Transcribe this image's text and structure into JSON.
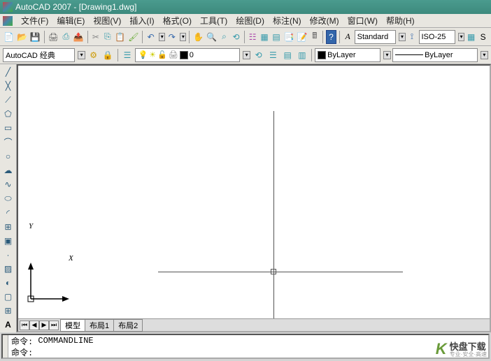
{
  "title": "AutoCAD 2007 - [Drawing1.dwg]",
  "menus": [
    "文件(F)",
    "编辑(E)",
    "视图(V)",
    "插入(I)",
    "格式(O)",
    "工具(T)",
    "绘图(D)",
    "标注(N)",
    "修改(M)",
    "窗口(W)",
    "帮助(H)"
  ],
  "toolbar1": {
    "style_combo": "Standard",
    "dimstyle_combo": "ISO-25",
    "sbtn": "S"
  },
  "toolbar2": {
    "workspace": "AutoCAD 经典",
    "layer_props": [
      "0"
    ],
    "color_combo": "ByLayer",
    "linetype_combo": "ByLayer"
  },
  "ucs": {
    "x": "X",
    "y": "Y"
  },
  "tabs": [
    "模型",
    "布局1",
    "布局2"
  ],
  "command": {
    "prefix": "命令:",
    "last": "COMMANDLINE",
    "current": "命令:"
  },
  "draw_tools": [
    "line",
    "xline",
    "polyline",
    "polygon",
    "rectangle",
    "arc",
    "circle",
    "revcloud",
    "spline",
    "ellipse",
    "ellipse-arc",
    "insert",
    "block",
    "point",
    "hatch",
    "gradient",
    "region",
    "table",
    "mtext"
  ],
  "watermark": {
    "logo": "K",
    "text": "快盘下载",
    "sub": "专业·安全·高速"
  }
}
